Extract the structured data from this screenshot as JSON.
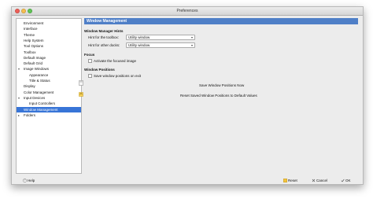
{
  "window": {
    "title": "Preferences"
  },
  "sidebar": {
    "items": [
      {
        "label": "Environment",
        "indent": 0
      },
      {
        "label": "Interface",
        "indent": 0
      },
      {
        "label": "Theme",
        "indent": 0
      },
      {
        "label": "Help System",
        "indent": 0
      },
      {
        "label": "Tool Options",
        "indent": 0
      },
      {
        "label": "Toolbox",
        "indent": 0
      },
      {
        "label": "Default Image",
        "indent": 0
      },
      {
        "label": "Default Grid",
        "indent": 0
      },
      {
        "label": "Image Windows",
        "indent": 0,
        "expander": "down"
      },
      {
        "label": "Appearance",
        "indent": 1
      },
      {
        "label": "Title & Status",
        "indent": 1
      },
      {
        "label": "Display",
        "indent": 0
      },
      {
        "label": "Color Management",
        "indent": 0
      },
      {
        "label": "Input Devices",
        "indent": 0,
        "expander": "down"
      },
      {
        "label": "Input Controllers",
        "indent": 1
      },
      {
        "label": "Window Management",
        "indent": 0,
        "selected": true
      },
      {
        "label": "Folders",
        "indent": 0,
        "expander": "right"
      }
    ]
  },
  "main": {
    "header": "Window Management",
    "hints": {
      "title": "Window Manager Hints",
      "toolbox_label": "Hint for the toolbox:",
      "toolbox_value": "Utility window",
      "docks_label": "Hint for other docks:",
      "docks_value": "Utility window"
    },
    "focus": {
      "title": "Focus",
      "activate_label": "Activate the focused image"
    },
    "positions": {
      "title": "Window Positions",
      "save_on_exit_label": "Save window positions on exit",
      "save_now_label": "Save Window Positions Now",
      "reset_label": "Reset Saved Window Positions to Default Values"
    }
  },
  "footer": {
    "help": "Help",
    "reset": "Reset",
    "cancel": "Cancel",
    "ok": "OK"
  }
}
